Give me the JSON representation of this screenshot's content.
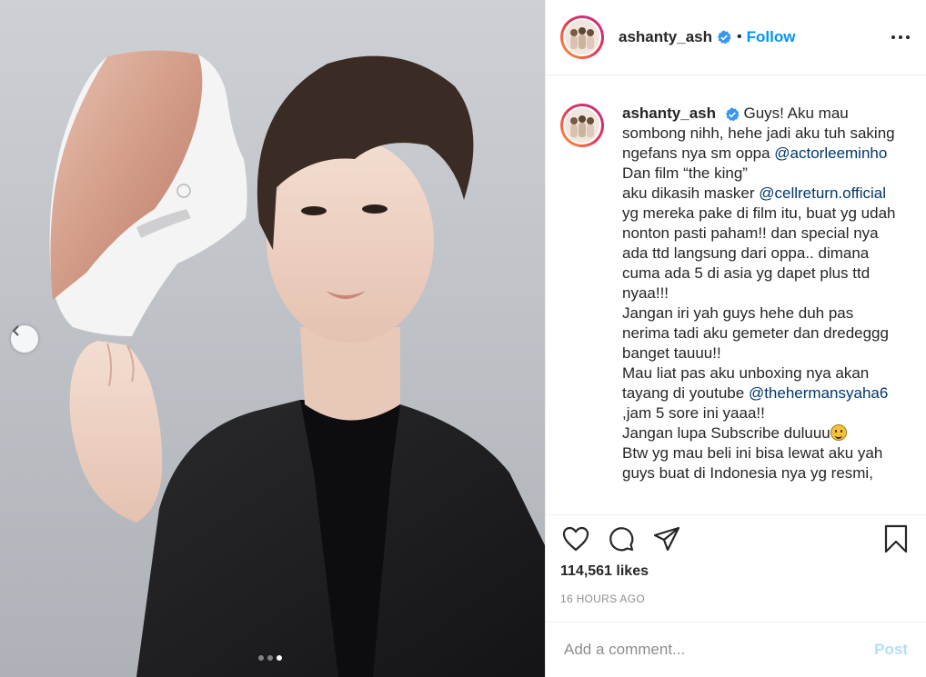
{
  "post": {
    "username": "ashanty_ash",
    "follow_label": "Follow",
    "separator": "•",
    "caption": {
      "username": "ashanty_ash",
      "segments": [
        {
          "type": "text",
          "value": "Guys! Aku mau sombong nihh, hehe jadi aku tuh saking ngefans nya sm oppa "
        },
        {
          "type": "mention",
          "value": "@actorleeminho"
        },
        {
          "type": "text",
          "value": " Dan film “the king”"
        },
        {
          "type": "break"
        },
        {
          "type": "text",
          "value": "aku dikasih masker "
        },
        {
          "type": "mention",
          "value": "@cellreturn.official"
        },
        {
          "type": "text",
          "value": " yg mereka pake di film itu, buat yg udah nonton pasti paham!! dan special nya ada ttd langsung dari oppa.. dimana cuma ada 5 di asia yg dapet plus ttd nyaa!!!"
        },
        {
          "type": "break"
        },
        {
          "type": "text",
          "value": "Jangan iri yah guys hehe duh pas nerima tadi aku gemeter dan dredeggg banget tauuu!!"
        },
        {
          "type": "break"
        },
        {
          "type": "text",
          "value": "Mau liat pas aku unboxing nya akan tayang di youtube "
        },
        {
          "type": "mention",
          "value": "@thehermansyaha6"
        },
        {
          "type": "text",
          "value": " ,jam 5 sore ini yaaa!!"
        },
        {
          "type": "break"
        },
        {
          "type": "text",
          "value": "Jangan lupa Subscribe duluuu"
        },
        {
          "type": "emoji",
          "value": "grinning-face"
        },
        {
          "type": "break"
        },
        {
          "type": "text",
          "value": "Btw yg mau beli ini bisa lewat aku yah guys buat di Indonesia nya yg resmi,"
        }
      ]
    },
    "likes_text": "114,561 likes",
    "timestamp": "16 HOURS AGO",
    "comment": {
      "placeholder": "Add a comment...",
      "post_label": "Post"
    },
    "carousel": {
      "total": 3,
      "active_index": 2
    }
  },
  "colors": {
    "follow_blue": "#0095f6",
    "mention_blue": "#00376b",
    "post_disabled": "#b2dffc",
    "secondary_text": "#8e8e8e",
    "verified_blue": "#3897f0"
  },
  "icons": {
    "verified": "verified-badge-icon",
    "more": "more-options-icon",
    "like": "heart-icon",
    "comment": "comment-bubble-icon",
    "share": "paper-plane-icon",
    "save": "bookmark-icon",
    "prev": "chevron-left-icon"
  }
}
